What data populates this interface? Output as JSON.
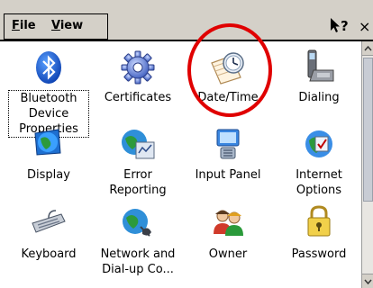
{
  "menubar": {
    "menus": [
      {
        "label": "File",
        "underline": "F",
        "rest": "ile"
      },
      {
        "label": "View",
        "underline": "V",
        "rest": "iew"
      }
    ],
    "help_label": "?",
    "close_label": "×"
  },
  "items": [
    {
      "label": "Bluetooth\nDevice\nProperties",
      "icon": "bluetooth-icon"
    },
    {
      "label": "Certificates",
      "icon": "gear-icon"
    },
    {
      "label": "Date/Time",
      "icon": "clock-calendar-icon"
    },
    {
      "label": "Dialing",
      "icon": "telephone-icon"
    },
    {
      "label": "Display",
      "icon": "display-globe-icon"
    },
    {
      "label": "Error\nReporting",
      "icon": "error-reporting-icon"
    },
    {
      "label": "Input Panel",
      "icon": "input-panel-icon"
    },
    {
      "label": "Internet\nOptions",
      "icon": "internet-options-icon"
    },
    {
      "label": "Keyboard",
      "icon": "keyboard-icon"
    },
    {
      "label": "Network and\nDial-up Co...",
      "icon": "network-globe-icon"
    },
    {
      "label": "Owner",
      "icon": "users-icon"
    },
    {
      "label": "Password",
      "icon": "keys-icon"
    }
  ],
  "colors": {
    "annotation": "#e00000",
    "menubar_bg": "#d4d0c8"
  }
}
